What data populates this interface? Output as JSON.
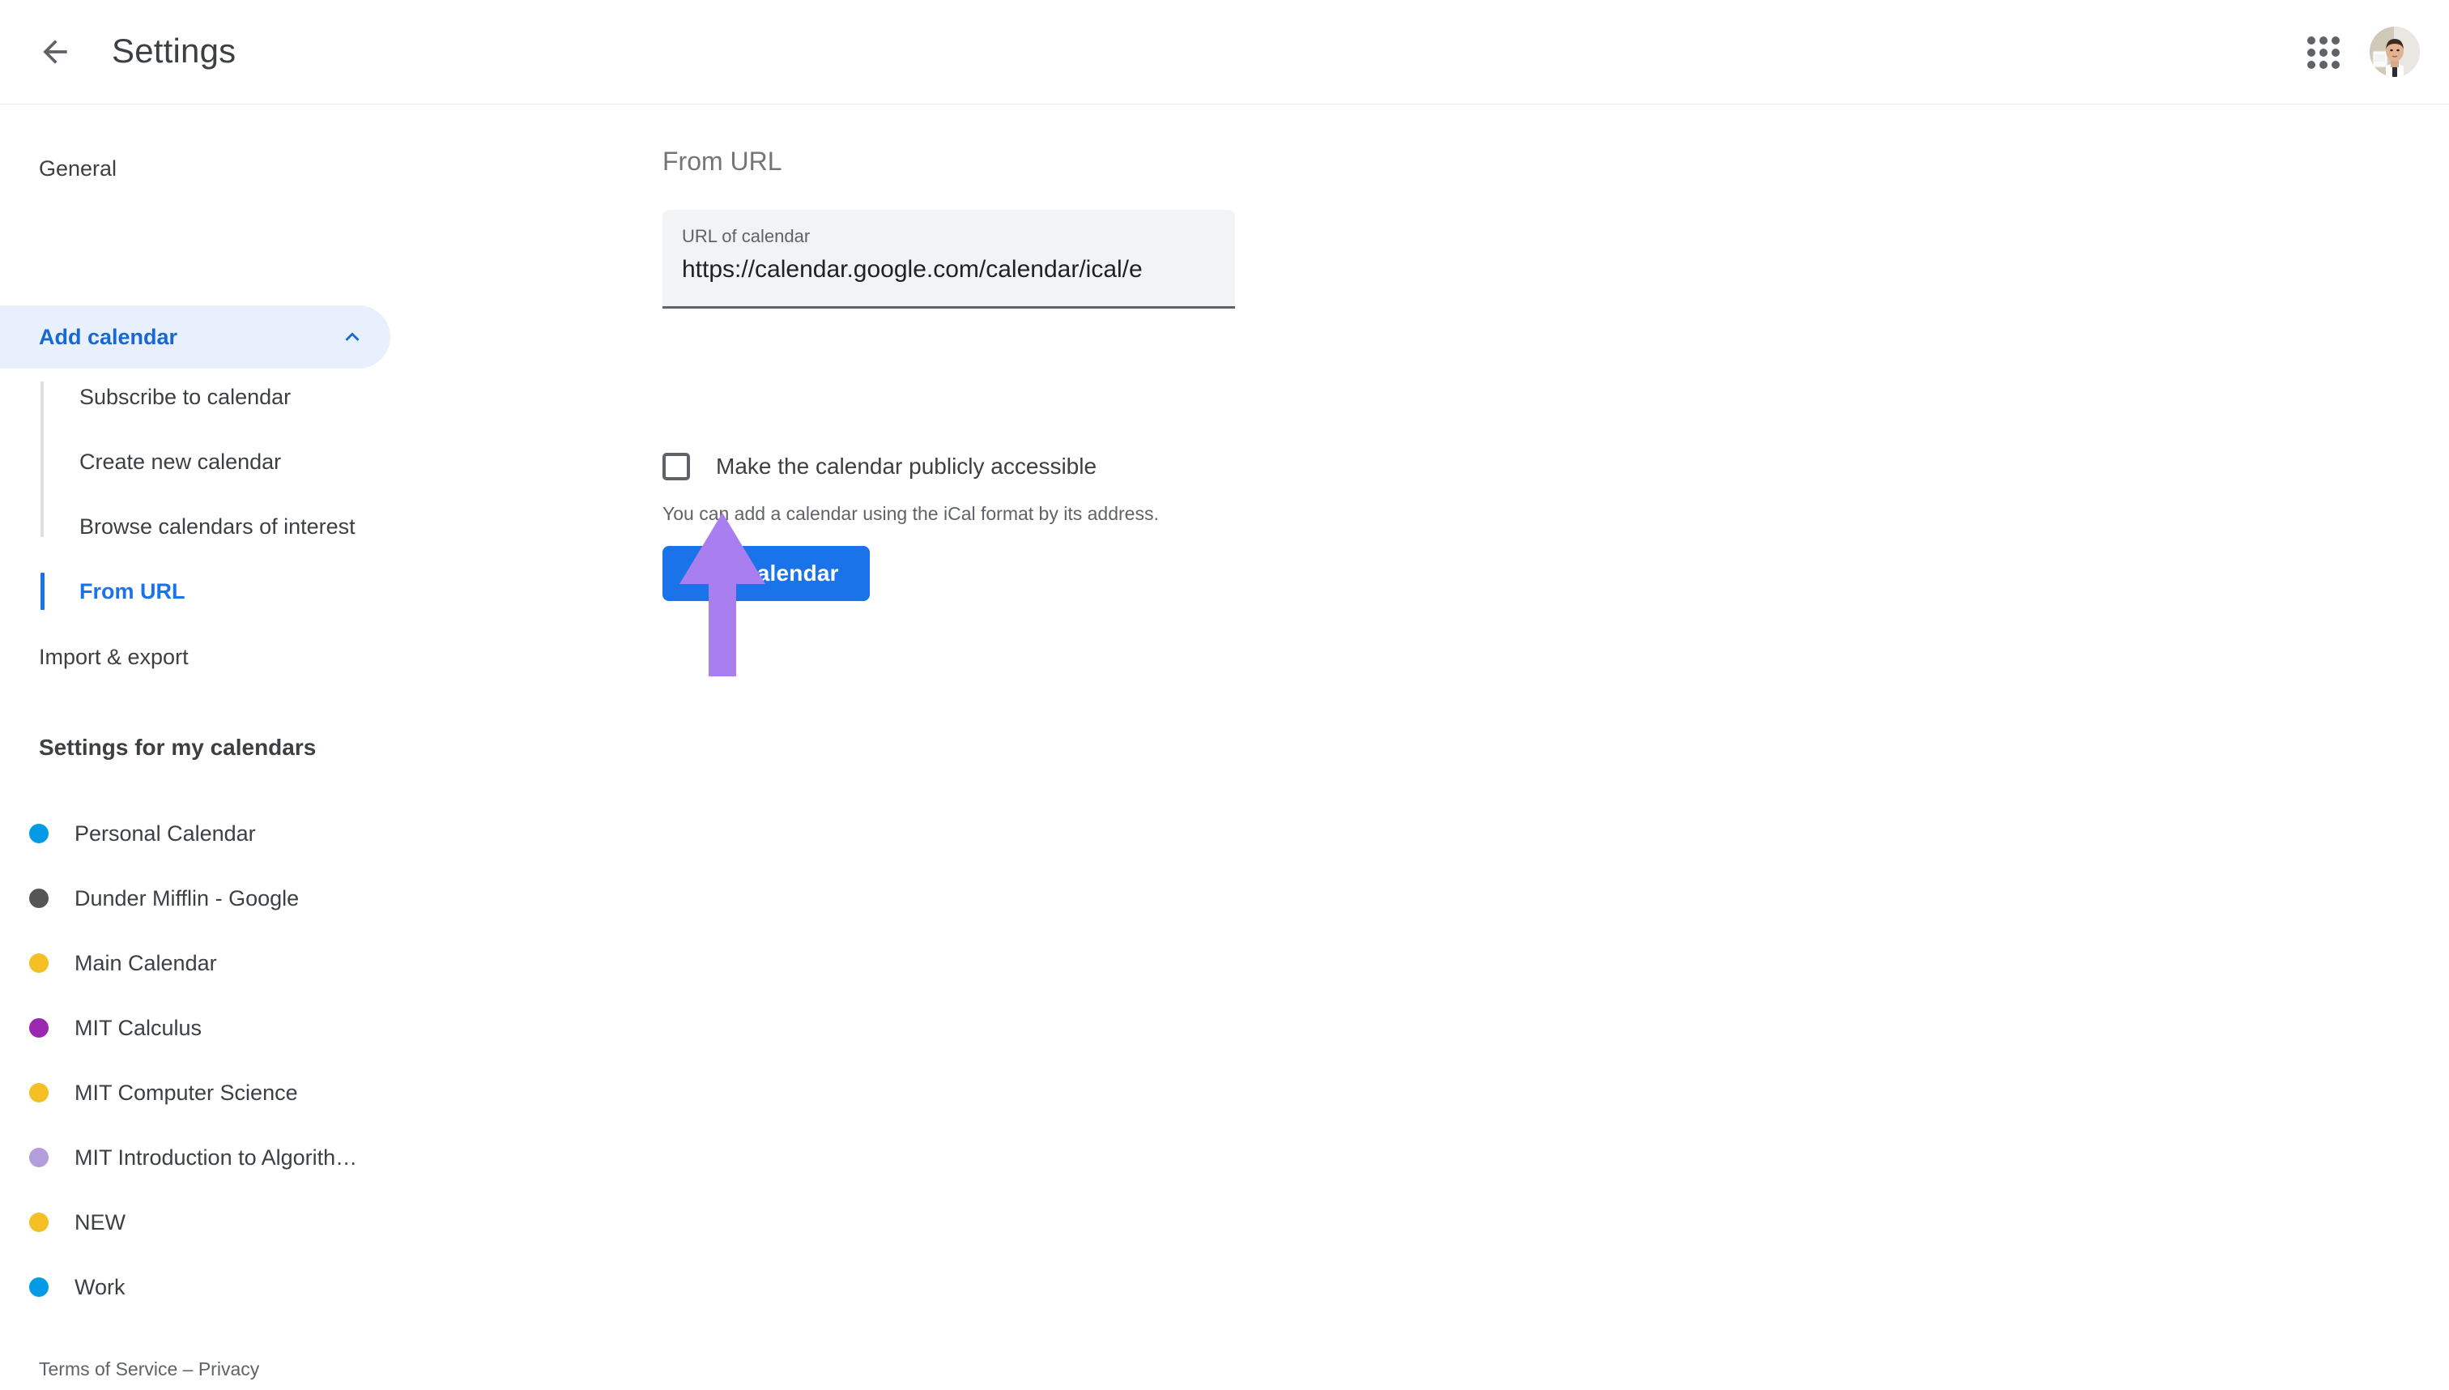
{
  "header": {
    "title": "Settings",
    "back_icon": "arrow-left-icon",
    "apps_icon": "apps-grid-icon",
    "avatar_icon": "user-avatar"
  },
  "sidebar": {
    "general_label": "General",
    "add_calendar": {
      "label": "Add calendar",
      "expanded": true,
      "chevron_icon": "chevron-up-icon"
    },
    "sub_items": [
      {
        "label": "Subscribe to calendar",
        "active": false
      },
      {
        "label": "Create new calendar",
        "active": false
      },
      {
        "label": "Browse calendars of interest",
        "active": false
      },
      {
        "label": "From URL",
        "active": true
      }
    ],
    "import_export_label": "Import & export",
    "calendars_section_title": "Settings for my calendars",
    "calendars": [
      {
        "name": "Personal Calendar",
        "color": "#039BE5"
      },
      {
        "name": "Dunder Mifflin - Google",
        "color": "#555555"
      },
      {
        "name": "Main Calendar",
        "color": "#F6BF26"
      },
      {
        "name": "MIT Calculus",
        "color": "#9C27B0"
      },
      {
        "name": "MIT Computer Science",
        "color": "#F6BF26"
      },
      {
        "name": "MIT Introduction to Algorith…",
        "color": "#B39DDB"
      },
      {
        "name": "NEW",
        "color": "#F6BF26"
      },
      {
        "name": "Work",
        "color": "#039BE5"
      }
    ],
    "footer_links": "Terms of Service – Privacy"
  },
  "main": {
    "heading": "From URL",
    "url_field": {
      "label": "URL of calendar",
      "value": "https://calendar.google.com/calendar/ical/e",
      "placeholder": "URL of calendar"
    },
    "checkbox": {
      "label": "Make the calendar publicly accessible",
      "checked": false
    },
    "helper_text": "You can add a calendar using the iCal format by its address.",
    "add_button_label": "Add calendar"
  },
  "annotation": {
    "arrow_color": "#A97FF0",
    "arrow_icon": "up-arrow-annotation"
  },
  "colors": {
    "accent_blue": "#1A73E8",
    "nav_active_bg": "#E8F0FE",
    "nav_active_text": "#1967D2",
    "text_primary": "#3C4043",
    "text_secondary": "#5F6368",
    "field_bg": "#F1F3F4"
  }
}
